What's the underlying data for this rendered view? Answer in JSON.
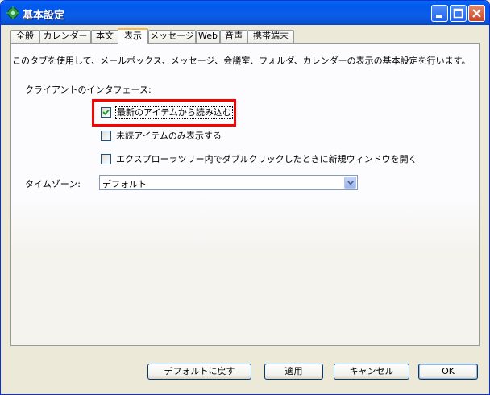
{
  "window": {
    "title": "基本設定"
  },
  "tabs": [
    {
      "label": "全般",
      "active": false
    },
    {
      "label": "カレンダー",
      "active": false
    },
    {
      "label": "本文",
      "active": false
    },
    {
      "label": "表示",
      "active": true
    },
    {
      "label": "メッセージ",
      "active": false
    },
    {
      "label": "Web",
      "active": false
    },
    {
      "label": "音声",
      "active": false
    },
    {
      "label": "携帯端末",
      "active": false
    }
  ],
  "panel": {
    "description": "このタブを使用して、メールボックス、メッセージ、会議室、フォルダ、カレンダーの表示の基本設定を行います。",
    "client_section_label": "クライアントのインタフェース:",
    "options": [
      {
        "label": "最新のアイテムから読み込む",
        "checked": true
      },
      {
        "label": "未読アイテムのみ表示する",
        "checked": false
      },
      {
        "label": "エクスプローラツリー内でダブルクリックしたときに新規ウィンドウを開く",
        "checked": false
      }
    ],
    "timezone_label": "タイムゾーン:",
    "timezone_value": "デフォルト"
  },
  "buttons": {
    "reset": "デフォルトに戻す",
    "apply": "適用",
    "cancel": "キャンセル",
    "ok": "OK"
  },
  "colors": {
    "titlebar": "#0058ee",
    "highlight": "#ff0000",
    "active_tab_accent": "#f7b94c"
  }
}
